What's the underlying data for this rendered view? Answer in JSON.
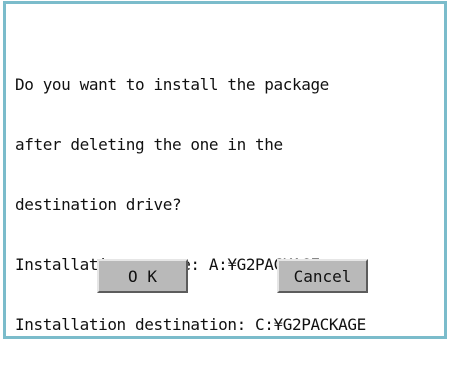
{
  "dialog": {
    "message_lines": [
      "Do you want to install the package",
      "after deleting the one in the",
      "destination drive?",
      "Installation source: A:¥G2PACKAGE",
      "Installation destination: C:¥G2PACKAGE"
    ],
    "ok_label": "O K",
    "cancel_label": "Cancel"
  },
  "colors": {
    "border": "#7bbccb",
    "button_face": "#b9b9b9",
    "background": "#ffffff"
  }
}
